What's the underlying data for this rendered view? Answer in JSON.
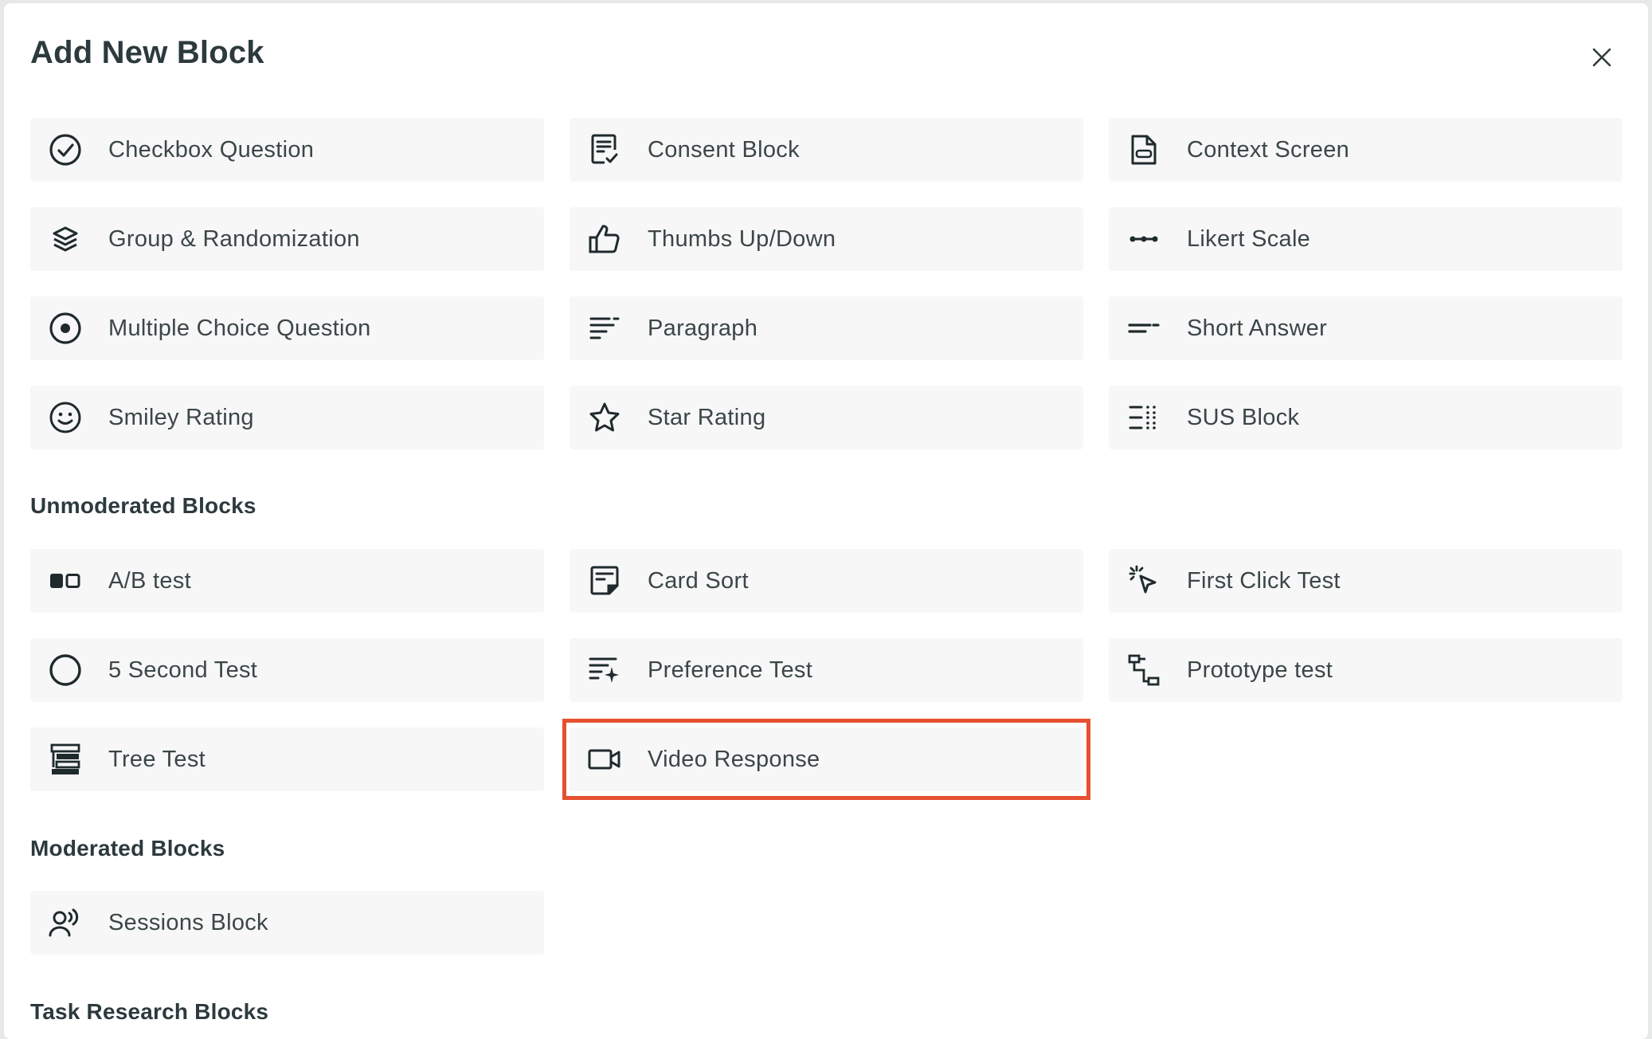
{
  "modal": {
    "title": "Add New Block",
    "close_icon": "close-icon"
  },
  "basic_blocks": [
    {
      "label": "Checkbox Question",
      "icon": "checkbox-circle-icon"
    },
    {
      "label": "Consent Block",
      "icon": "consent-document-icon"
    },
    {
      "label": "Context Screen",
      "icon": "context-document-icon"
    },
    {
      "label": "Group & Randomization",
      "icon": "layers-icon"
    },
    {
      "label": "Thumbs Up/Down",
      "icon": "thumbs-up-icon"
    },
    {
      "label": "Likert Scale",
      "icon": "likert-dots-icon"
    },
    {
      "label": "Multiple Choice Question",
      "icon": "radio-button-icon"
    },
    {
      "label": "Paragraph",
      "icon": "paragraph-lines-icon"
    },
    {
      "label": "Short Answer",
      "icon": "short-answer-icon"
    },
    {
      "label": "Smiley Rating",
      "icon": "smiley-icon"
    },
    {
      "label": "Star Rating",
      "icon": "star-icon"
    },
    {
      "label": "SUS Block",
      "icon": "sus-list-icon"
    }
  ],
  "sections": {
    "unmoderated": "Unmoderated Blocks",
    "moderated": "Moderated Blocks",
    "task_research": "Task Research Blocks"
  },
  "unmoderated_blocks": [
    {
      "label": "A/B test",
      "icon": "ab-test-icon"
    },
    {
      "label": "Card Sort",
      "icon": "card-sort-icon"
    },
    {
      "label": "First Click Test",
      "icon": "click-cursor-icon"
    },
    {
      "label": "5 Second Test",
      "icon": "circle-icon"
    },
    {
      "label": "Preference Test",
      "icon": "sparkle-lines-icon"
    },
    {
      "label": "Prototype test",
      "icon": "prototype-flow-icon"
    },
    {
      "label": "Tree Test",
      "icon": "tree-list-icon"
    },
    {
      "label": "Video Response",
      "icon": "video-camera-icon"
    }
  ],
  "moderated_blocks": [
    {
      "label": "Sessions Block",
      "icon": "person-speaking-icon"
    }
  ],
  "highlight_color": "#e5512f"
}
